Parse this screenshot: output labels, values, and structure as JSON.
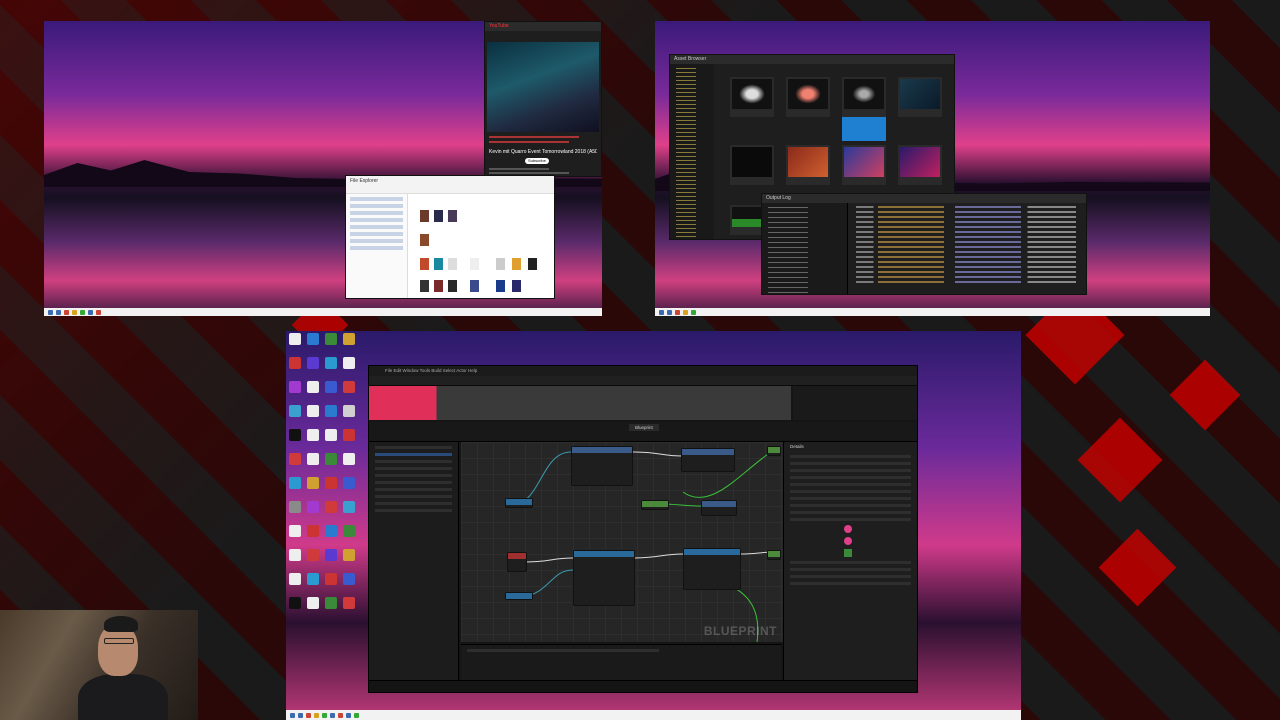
{
  "monitor_top_left": {
    "youtube": {
      "brand": "YouTube",
      "video_title": "Kevin mit Quarro Event Tomorrowland 2018 (A5DE Stage)",
      "subscribe_label": "Subscribe"
    },
    "explorer": {
      "title": "File Explorer"
    }
  },
  "monitor_top_right": {
    "asset_browser": {
      "title": "Asset Browser"
    },
    "output_log": {
      "title": "Output Log"
    }
  },
  "monitor_bottom": {
    "unreal": {
      "menubar": "File  Edit  Window  Tools  Build  Select  Actor  Help",
      "tab_label": "Blueprint",
      "watermark": "BLUEPRINT",
      "details_title": "Details"
    }
  },
  "colors": {
    "brand_red": "#cc0000",
    "wallpaper_pink": "#e0408a",
    "wallpaper_purple": "#3a1a7a",
    "unreal_dark": "#151515"
  }
}
